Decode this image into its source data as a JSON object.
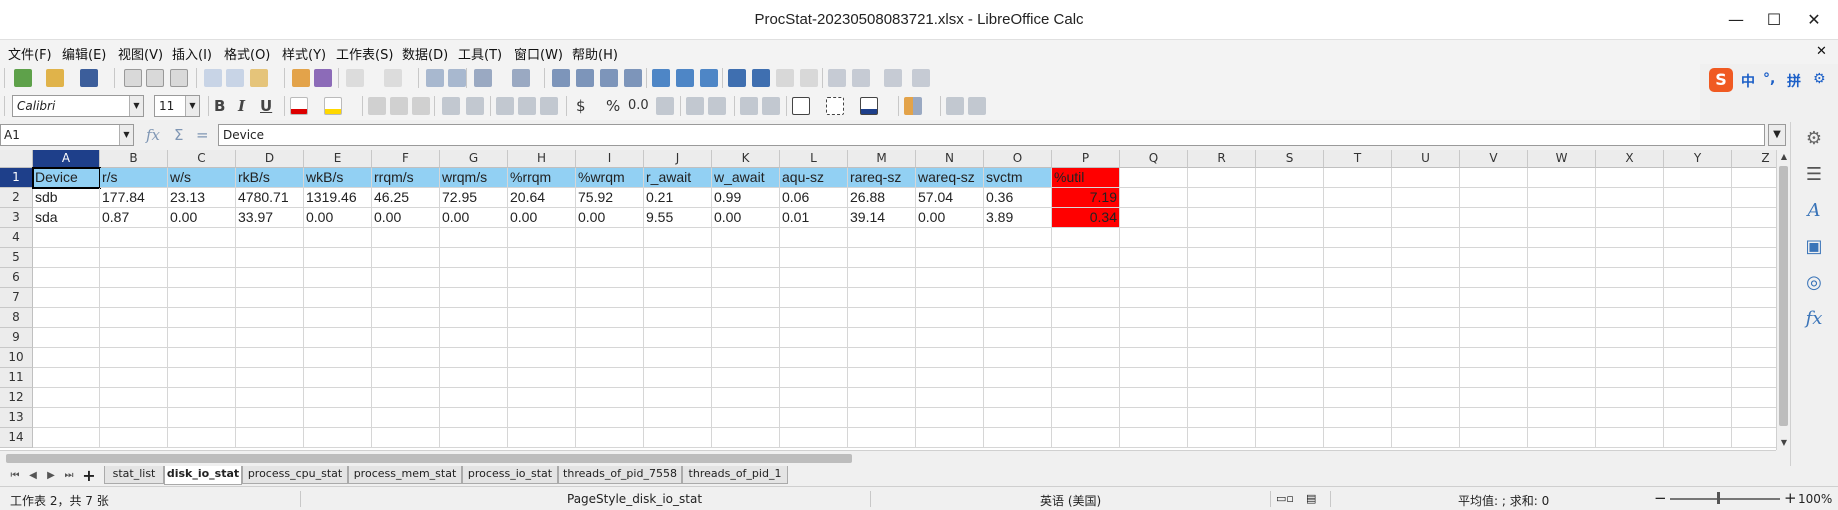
{
  "window": {
    "title": "ProcStat-20230508083721.xlsx - LibreOffice Calc",
    "minimize_glyph": "—",
    "maximize_glyph": "☐",
    "close_glyph": "✕"
  },
  "menu": [
    "文件(F)",
    "编辑(E)",
    "视图(V)",
    "插入(I)",
    "格式(O)",
    "样式(Y)",
    "工作表(S)",
    "数据(D)",
    "工具(T)",
    "窗口(W)",
    "帮助(H)"
  ],
  "menu_close_glyph": "✕",
  "toolbar": {
    "font_name": "Calibri",
    "font_size": "11",
    "bold": "B",
    "italic": "I",
    "underline": "U",
    "currency": "$",
    "percent": "%",
    "number": "0.0"
  },
  "ime": {
    "logo": "S",
    "lang": "中",
    "punct": "°,",
    "mode": "拼"
  },
  "formula_bar": {
    "name_box": "A1",
    "fx_label": "fx",
    "sum_label": "Σ",
    "eq_label": "=",
    "content": "Device"
  },
  "grid": {
    "columns": [
      "A",
      "B",
      "C",
      "D",
      "E",
      "F",
      "G",
      "H",
      "I",
      "J",
      "K",
      "L",
      "M",
      "N",
      "O",
      "P",
      "Q",
      "R",
      "S",
      "T",
      "U",
      "V",
      "W",
      "X",
      "Y",
      "Z"
    ],
    "rows": [
      "1",
      "2",
      "3",
      "4",
      "5",
      "6",
      "7",
      "8",
      "9",
      "10",
      "11",
      "12",
      "13",
      "14"
    ],
    "header_row": [
      "Device",
      "r/s",
      "w/s",
      "rkB/s",
      "wkB/s",
      "rrqm/s",
      "wrqm/s",
      "%rrqm",
      "%wrqm",
      "r_await",
      "w_await",
      "aqu-sz",
      "rareq-sz",
      "wareq-sz",
      "svctm",
      "%util"
    ],
    "data_rows": [
      [
        "sdb",
        "177.84",
        "23.13",
        "4780.71",
        "1319.46",
        "46.25",
        "72.95",
        "20.64",
        "75.92",
        "0.21",
        "0.99",
        "0.06",
        "26.88",
        "57.04",
        "0.36",
        "7.19"
      ],
      [
        "sda",
        "0.87",
        "0.00",
        "33.97",
        "0.00",
        "0.00",
        "0.00",
        "0.00",
        "0.00",
        "9.55",
        "0.00",
        "0.01",
        "39.14",
        "0.00",
        "3.89",
        "0.34"
      ]
    ],
    "header_color": "#92d0f3",
    "alert_color": "#ff0000"
  },
  "sheets": {
    "add_glyph": "+",
    "tabs": [
      "stat_list",
      "disk_io_stat",
      "process_cpu_stat",
      "process_mem_stat",
      "process_io_stat",
      "threads_of_pid_7558",
      "threads_of_pid_1"
    ],
    "active": "disk_io_stat"
  },
  "status": {
    "sheet_info": "工作表 2，共 7 张",
    "page_style": "PageStyle_disk_io_stat",
    "language": "英语 (美国)",
    "summary": "平均值: ; 求和: 0",
    "zoom_minus": "−",
    "zoom_plus": "+",
    "zoom": "100%"
  }
}
